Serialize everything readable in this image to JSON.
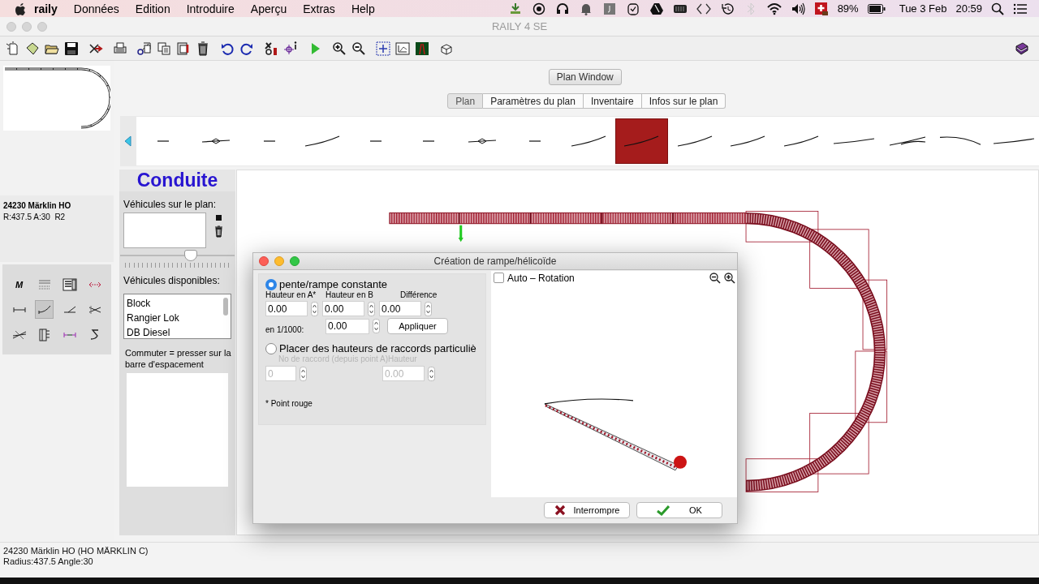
{
  "menubar": {
    "app": "raily",
    "items": [
      "Données",
      "Edition",
      "Introduire",
      "Aperçu",
      "Extras",
      "Help"
    ],
    "battery": "89%",
    "date": "Tue 3 Feb",
    "time": "20:59"
  },
  "window": {
    "title": "RAILY 4 SE"
  },
  "plan_window_button": "Plan Window",
  "tabs": [
    {
      "label": "Plan",
      "selected": true
    },
    {
      "label": "Paramètres du plan",
      "selected": false
    },
    {
      "label": "Inventaire",
      "selected": false
    },
    {
      "label": "Infos sur le plan",
      "selected": false
    }
  ],
  "track_pieces": [
    {
      "kind": "short",
      "selected": false
    },
    {
      "kind": "switch",
      "selected": false
    },
    {
      "kind": "short",
      "selected": false
    },
    {
      "kind": "curve",
      "selected": false
    },
    {
      "kind": "short",
      "selected": false
    },
    {
      "kind": "short",
      "selected": false
    },
    {
      "kind": "switch",
      "selected": false
    },
    {
      "kind": "short",
      "selected": false
    },
    {
      "kind": "curve",
      "selected": false
    },
    {
      "kind": "curve",
      "selected": true
    },
    {
      "kind": "curve",
      "selected": false
    },
    {
      "kind": "curve",
      "selected": false
    },
    {
      "kind": "curve",
      "selected": false
    },
    {
      "kind": "long",
      "selected": false
    },
    {
      "kind": "fork",
      "selected": false
    },
    {
      "kind": "arch",
      "selected": false
    },
    {
      "kind": "long",
      "selected": false
    }
  ],
  "part_info": {
    "title": "24230 Märklin HO",
    "detail": "R:437.5 A:30  R2"
  },
  "tools": [
    {
      "kind": "letter",
      "label": "M",
      "selected": false
    },
    {
      "kind": "lines",
      "selected": false
    },
    {
      "kind": "form",
      "selected": false
    },
    {
      "kind": "measure",
      "selected": false
    },
    {
      "kind": "straight",
      "selected": false
    },
    {
      "kind": "curve",
      "selected": true
    },
    {
      "kind": "switch",
      "selected": false
    },
    {
      "kind": "cross",
      "selected": false
    },
    {
      "kind": "crossing",
      "selected": false
    },
    {
      "kind": "ladder",
      "selected": false
    },
    {
      "kind": "connector",
      "selected": false
    },
    {
      "kind": "s",
      "selected": false
    }
  ],
  "conduite": {
    "title": "Conduite",
    "on_plan_label": "Véhicules sur le plan:",
    "speed": {
      "level": 0.63
    },
    "available_label": "Véhicules disponibles:",
    "vehicles": [
      {
        "name": "Block",
        "selected": false
      },
      {
        "name": "Rangier Lok",
        "selected": false
      },
      {
        "name": "DB Diesel",
        "selected": false
      }
    ],
    "hint": "Commuter = presser sur la barre d'espacement"
  },
  "dialog": {
    "title": "Création de rampe/hélicoïde",
    "constant": {
      "label": "pente/rampe constante",
      "selected": true,
      "columns": [
        "Hauteur en A*",
        "Hauteur en B",
        "Différence"
      ],
      "values": [
        "0.00",
        "0.00",
        "0.00"
      ],
      "per_mille_label": "en 1/1000:",
      "per_mille": "0.00",
      "apply": "Appliquer"
    },
    "particular": {
      "label": "Placer des hauteurs de raccords particuliè",
      "selected": false,
      "disabled": true,
      "columns_label": "No de raccord (depuis point A)Hauteur",
      "values": [
        "0",
        "0.00"
      ]
    },
    "footnote": "* Point rouge",
    "auto_rotation": {
      "label": "Auto – Rotation",
      "checked": false
    },
    "cancel": "Interrompre",
    "ok": "OK"
  },
  "status_bar": {
    "lines": [
      "24230 Märklin HO (HO MÄRKLIN C)",
      "Radius:437.5 Angle:30"
    ]
  }
}
